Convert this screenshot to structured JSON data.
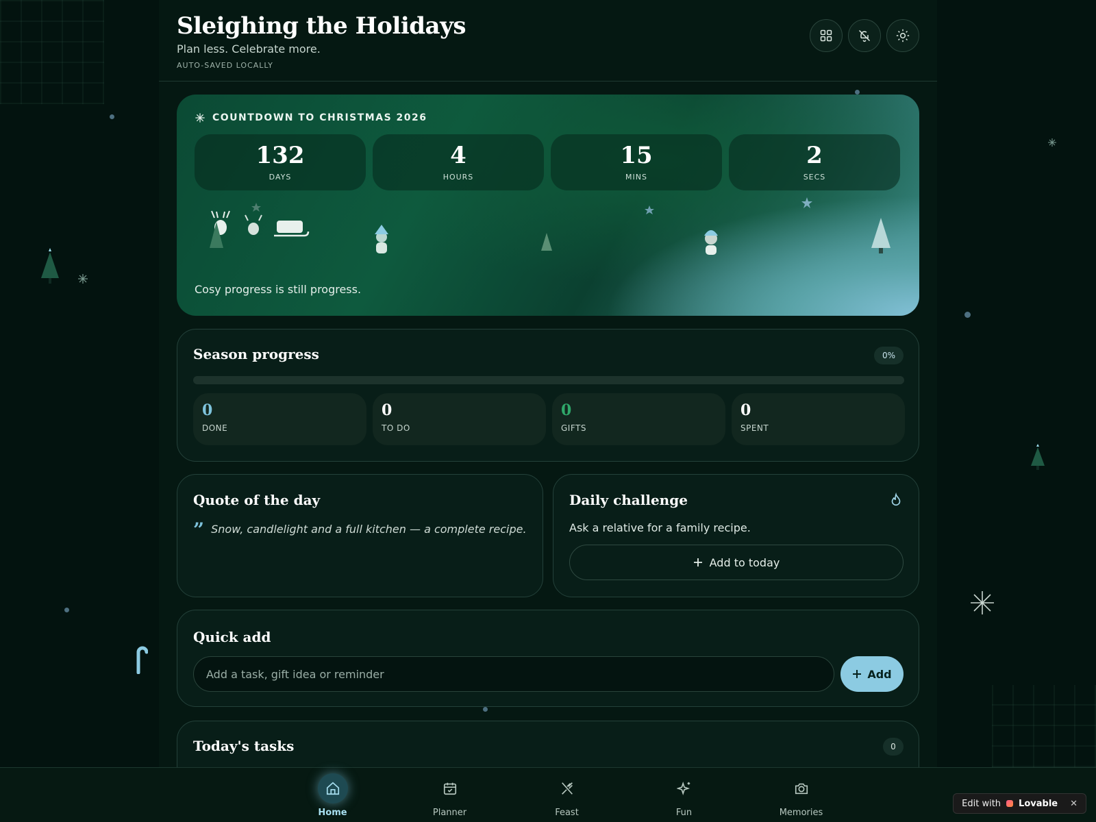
{
  "header": {
    "title": "Sleighing the Holidays",
    "tagline": "Plan less. Celebrate more.",
    "autosave": "AUTO-SAVED LOCALLY",
    "icons": [
      "grid-icon",
      "bell-off-icon",
      "sun-icon"
    ]
  },
  "countdown": {
    "label": "COUNTDOWN TO CHRISTMAS 2026",
    "units": [
      {
        "value": "132",
        "label": "DAYS"
      },
      {
        "value": "4",
        "label": "HOURS"
      },
      {
        "value": "15",
        "label": "MINS"
      },
      {
        "value": "2",
        "label": "SECS"
      }
    ],
    "message": "Cosy progress is still progress."
  },
  "progress": {
    "title": "Season progress",
    "percent_label": "0%",
    "percent_value": 0,
    "stats": [
      {
        "value": "0",
        "label": "DONE",
        "color": "#7ec3dc"
      },
      {
        "value": "0",
        "label": "TO DO",
        "color": "#ffffff"
      },
      {
        "value": "0",
        "label": "GIFTS",
        "color": "#2fa86a"
      },
      {
        "value": "0",
        "label": "SPENT",
        "color": "#ffffff"
      }
    ]
  },
  "quote": {
    "title": "Quote of the day",
    "mark": "”",
    "text": "Snow, candlelight and a full kitchen — a complete recipe."
  },
  "challenge": {
    "title": "Daily challenge",
    "text": "Ask a relative for a family recipe.",
    "button": "Add to today"
  },
  "quick_add": {
    "title": "Quick add",
    "placeholder": "Add a task, gift idea or reminder",
    "button": "Add"
  },
  "tasks": {
    "title": "Today's tasks",
    "count": "0"
  },
  "nav": {
    "items": [
      {
        "label": "Home",
        "icon": "home-icon"
      },
      {
        "label": "Planner",
        "icon": "calendar-check-icon"
      },
      {
        "label": "Feast",
        "icon": "utensils-icon"
      },
      {
        "label": "Fun",
        "icon": "sparkles-icon"
      },
      {
        "label": "Memories",
        "icon": "camera-icon"
      }
    ],
    "active": "Home"
  },
  "lovable": {
    "prefix": "Edit with",
    "brand": "Lovable",
    "close": "✕"
  },
  "colors": {
    "accent": "#7ec3dc",
    "background": "#03130f",
    "card": "#081e18"
  }
}
